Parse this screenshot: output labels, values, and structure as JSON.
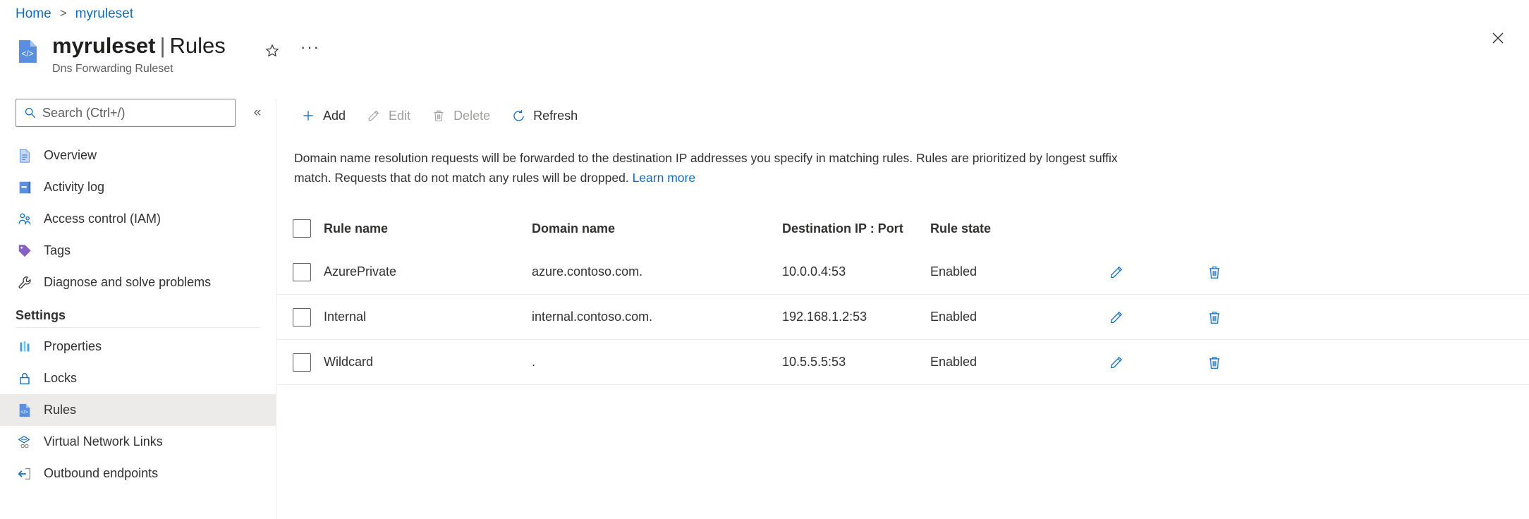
{
  "breadcrumb": {
    "home": "Home",
    "separator": ">",
    "current": "myruleset"
  },
  "header": {
    "resource_name": "myruleset",
    "title_separator": "|",
    "page_name": "Rules",
    "subtitle": "Dns Forwarding Ruleset",
    "favorite_icon": "star-icon",
    "more_icon": "ellipsis-icon",
    "close_icon": "close-icon"
  },
  "sidebar": {
    "search": {
      "placeholder": "Search (Ctrl+/)",
      "value": "",
      "icon": "search-icon"
    },
    "collapse_icon": "double-chevron-left-icon",
    "items": [
      {
        "label": "Overview",
        "icon": "overview-icon",
        "selected": false
      },
      {
        "label": "Activity log",
        "icon": "activity-log-icon",
        "selected": false
      },
      {
        "label": "Access control (IAM)",
        "icon": "people-icon",
        "selected": false
      },
      {
        "label": "Tags",
        "icon": "tag-icon",
        "selected": false
      },
      {
        "label": "Diagnose and solve problems",
        "icon": "wrench-icon",
        "selected": false
      }
    ],
    "group_title": "Settings",
    "settings_items": [
      {
        "label": "Properties",
        "icon": "properties-icon",
        "selected": false
      },
      {
        "label": "Locks",
        "icon": "lock-icon",
        "selected": false
      },
      {
        "label": "Rules",
        "icon": "rules-icon",
        "selected": true
      },
      {
        "label": "Virtual Network Links",
        "icon": "virtual-network-links-icon",
        "selected": false
      },
      {
        "label": "Outbound endpoints",
        "icon": "outbound-endpoints-icon",
        "selected": false
      }
    ]
  },
  "toolbar": {
    "add": {
      "label": "Add",
      "icon": "plus-icon",
      "disabled": false
    },
    "edit": {
      "label": "Edit",
      "icon": "pencil-icon",
      "disabled": true
    },
    "delete": {
      "label": "Delete",
      "icon": "trash-icon",
      "disabled": true
    },
    "refresh": {
      "label": "Refresh",
      "icon": "refresh-icon",
      "disabled": false
    }
  },
  "description": {
    "text": "Domain name resolution requests will be forwarded to the destination IP addresses you specify in matching rules. Rules are prioritized by longest suffix match. Requests that do not match any rules will be dropped. ",
    "link_label": "Learn more"
  },
  "table": {
    "columns": [
      "Rule name",
      "Domain name",
      "Destination IP : Port",
      "Rule state"
    ],
    "rows": [
      {
        "rule_name": "AzurePrivate",
        "domain_name": "azure.contoso.com.",
        "destination": "10.0.0.4:53",
        "rule_state": "Enabled",
        "edit_icon": "pencil-icon",
        "delete_icon": "trash-icon"
      },
      {
        "rule_name": "Internal",
        "domain_name": "internal.contoso.com.",
        "destination": "192.168.1.2:53",
        "rule_state": "Enabled",
        "edit_icon": "pencil-icon",
        "delete_icon": "trash-icon"
      },
      {
        "rule_name": "Wildcard",
        "domain_name": ".",
        "destination": "10.5.5.5:53",
        "rule_state": "Enabled",
        "edit_icon": "pencil-icon",
        "delete_icon": "trash-icon"
      }
    ]
  },
  "colors": {
    "accent": "#0f6cbd",
    "link": "#0f6cbd",
    "selected_row": "#edebe9",
    "text": "#323130",
    "muted": "#605e5c",
    "disabled": "#a19f9d",
    "border": "#edebe9"
  }
}
